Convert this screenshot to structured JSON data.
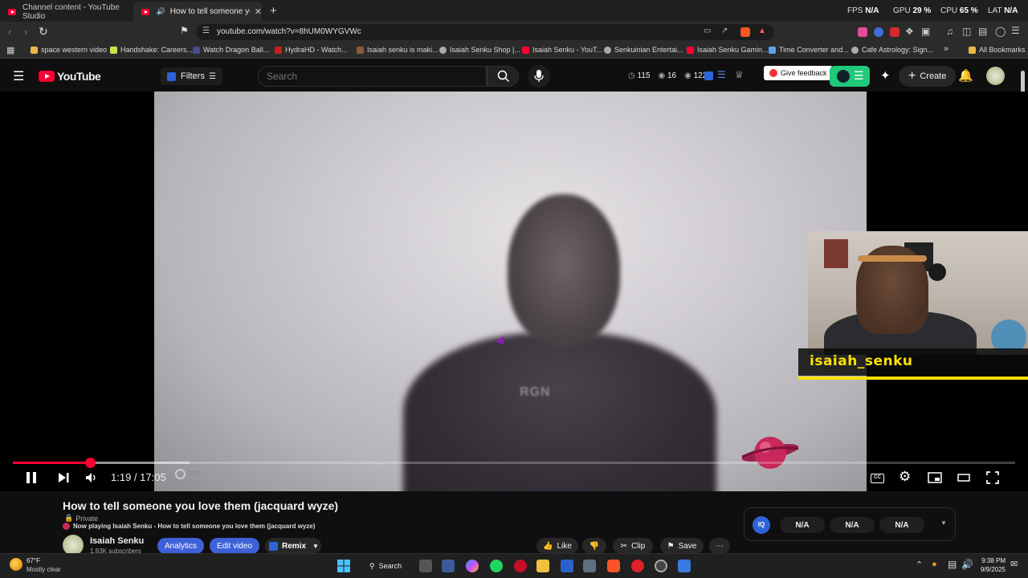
{
  "browser": {
    "tabs": [
      {
        "label": "Channel content - YouTube Studio"
      },
      {
        "label": "How to tell someone you lovе"
      }
    ],
    "perf": {
      "fps_label": "FPS",
      "fps": "N/A",
      "gpu_label": "GPU",
      "gpu": "29 %",
      "cpu_label": "CPU",
      "cpu": "65 %",
      "lat_label": "LAT",
      "lat": "N/A"
    },
    "url": "youtube.com/watch?v=8hUM0WYGVWc",
    "bookmarks": [
      "space western video",
      "Handshake: Careers...",
      "Watch Dragon Ball...",
      "HydraHD - Watch...",
      "Isaiah senku is maki...",
      "Isaiah Senku Shop |...",
      "Isaiah Senku - YouT...",
      "Senkuinian Entertai...",
      "Isaiah Senku Gamin...",
      "Time Converter and...",
      "Cafe Astrology: Sign...",
      "All Bookmarks"
    ]
  },
  "youtube": {
    "logo": "YouTube",
    "filters": "Filters",
    "search_placeholder": "Search",
    "stats": [
      "115",
      "16",
      "122"
    ],
    "give_feedback": "Give feedback",
    "create": "Create"
  },
  "video": {
    "shirt_text": "RGN",
    "overlay_name": "isaiah_senku",
    "progress": {
      "played": 0.077,
      "buffered": 0.176
    },
    "current_time": "1:19",
    "duration": "17:05",
    "time_display": "1:19 / 17:05",
    "autoplay_label": "OFF"
  },
  "details": {
    "title": "How to tell someone you love them (jacquard wyze)",
    "privacy": "Private",
    "now_playing": "Now playing Isaiah Senku - How to tell someone you love them (jacquard wyze)",
    "channel": "Isaiah Senku",
    "subscribers": "1.83K subscribers",
    "analytics": "Analytics",
    "edit_video": "Edit video",
    "remix": "Remix",
    "like": "Like",
    "clip": "Clip",
    "save": "Save",
    "iq_badge": "IQ",
    "iq_values": [
      "N/A",
      "N/A",
      "N/A"
    ]
  },
  "taskbar": {
    "temp": "67°F",
    "weather": "Mostly clear",
    "search": "Search",
    "time": "9:38 PM",
    "date": "9/9/2025"
  }
}
